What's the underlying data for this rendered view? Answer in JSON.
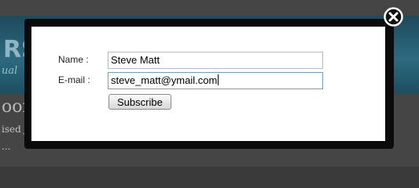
{
  "background": {
    "header_text": "RS",
    "header_sub": "ual",
    "heading": "oon",
    "text_line_1": "ised J",
    "text_line_2": "..."
  },
  "form": {
    "name_label": "Name :",
    "name_value": "Steve Matt",
    "email_label": "E-mail :",
    "email_value": "steve_matt@ymail.com",
    "subscribe_label": "Subscribe"
  },
  "colors": {
    "overlay": "#454545",
    "modal_frame": "#0b0b0b",
    "modal_body": "#ffffff",
    "header_band": "#2c6a80"
  },
  "icons": {
    "close": "close-icon"
  }
}
